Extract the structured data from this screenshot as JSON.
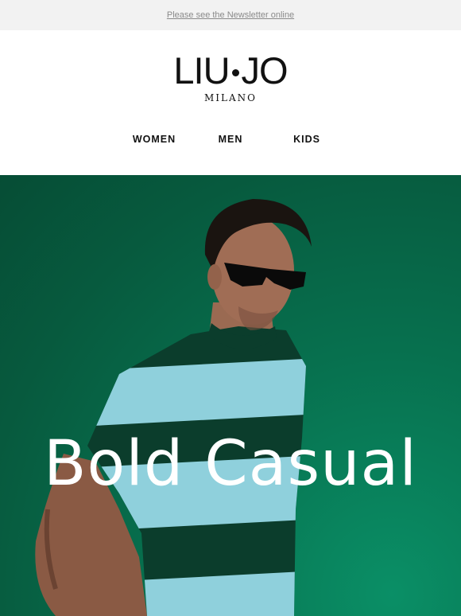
{
  "preheader": {
    "link_text": "Please see the Newsletter online"
  },
  "brand": {
    "name_left": "LIU",
    "name_right": "JO",
    "tagline": "MILANO"
  },
  "nav": {
    "items": [
      {
        "label": "WOMEN"
      },
      {
        "label": "MEN"
      },
      {
        "label": "KIDS"
      }
    ]
  },
  "hero": {
    "title": "Bold Casual",
    "background_color": "#07714f",
    "image_subject": "man-in-striped-tshirt-sunglasses"
  }
}
